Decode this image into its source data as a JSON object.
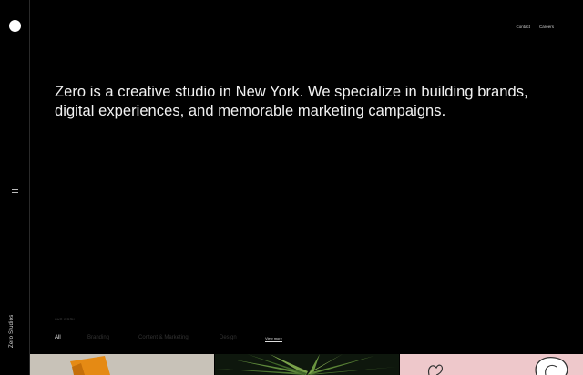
{
  "brand": {
    "name": "Zero Studios"
  },
  "nav": {
    "links": [
      "Contact",
      "Careers"
    ]
  },
  "hero": {
    "text": "Zero is a creative studio in New York. We specialize in building brands, digital experiences, and memorable marketing campaigns."
  },
  "work": {
    "section_label": "OUR WORK",
    "filters": [
      "All",
      "Branding",
      "Content & Marketing",
      "Design"
    ],
    "active_filter": "All",
    "view_more": "View more"
  },
  "icons": {
    "logo": "circle-logo-icon",
    "menu": "hamburger-menu-icon"
  },
  "colors": {
    "background": "#000000",
    "text": "#f2f2f2",
    "muted": "#333333"
  }
}
